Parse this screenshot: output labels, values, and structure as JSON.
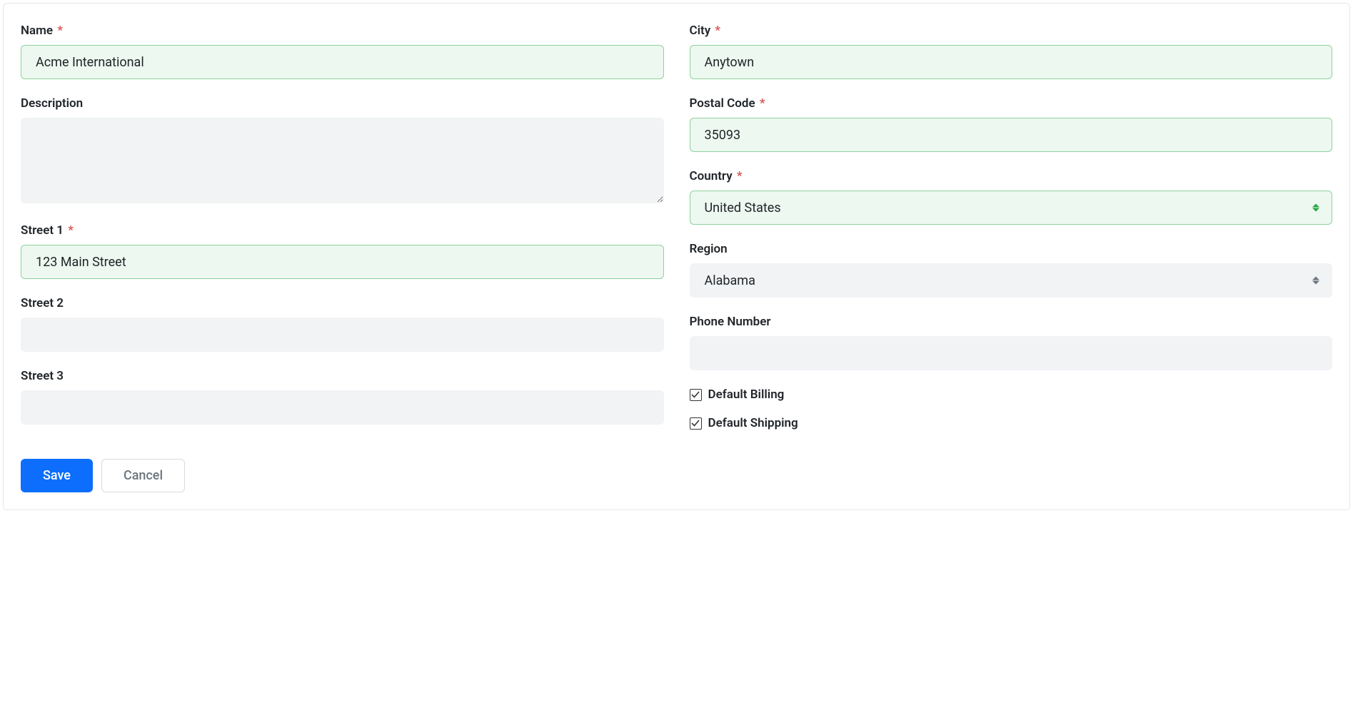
{
  "fields": {
    "name": {
      "label": "Name",
      "value": "Acme International",
      "required": true
    },
    "description": {
      "label": "Description",
      "value": "",
      "required": false
    },
    "street1": {
      "label": "Street 1",
      "value": "123 Main Street",
      "required": true
    },
    "street2": {
      "label": "Street 2",
      "value": "",
      "required": false
    },
    "street3": {
      "label": "Street 3",
      "value": "",
      "required": false
    },
    "city": {
      "label": "City",
      "value": "Anytown",
      "required": true
    },
    "postal_code": {
      "label": "Postal Code",
      "value": "35093",
      "required": true
    },
    "country": {
      "label": "Country",
      "value": "United States",
      "required": true
    },
    "region": {
      "label": "Region",
      "value": "Alabama",
      "required": false
    },
    "phone": {
      "label": "Phone Number",
      "value": "",
      "required": false
    },
    "default_billing": {
      "label": "Default Billing",
      "checked": true
    },
    "default_shipping": {
      "label": "Default Shipping",
      "checked": true
    }
  },
  "buttons": {
    "save": "Save",
    "cancel": "Cancel"
  },
  "required_mark": "*"
}
